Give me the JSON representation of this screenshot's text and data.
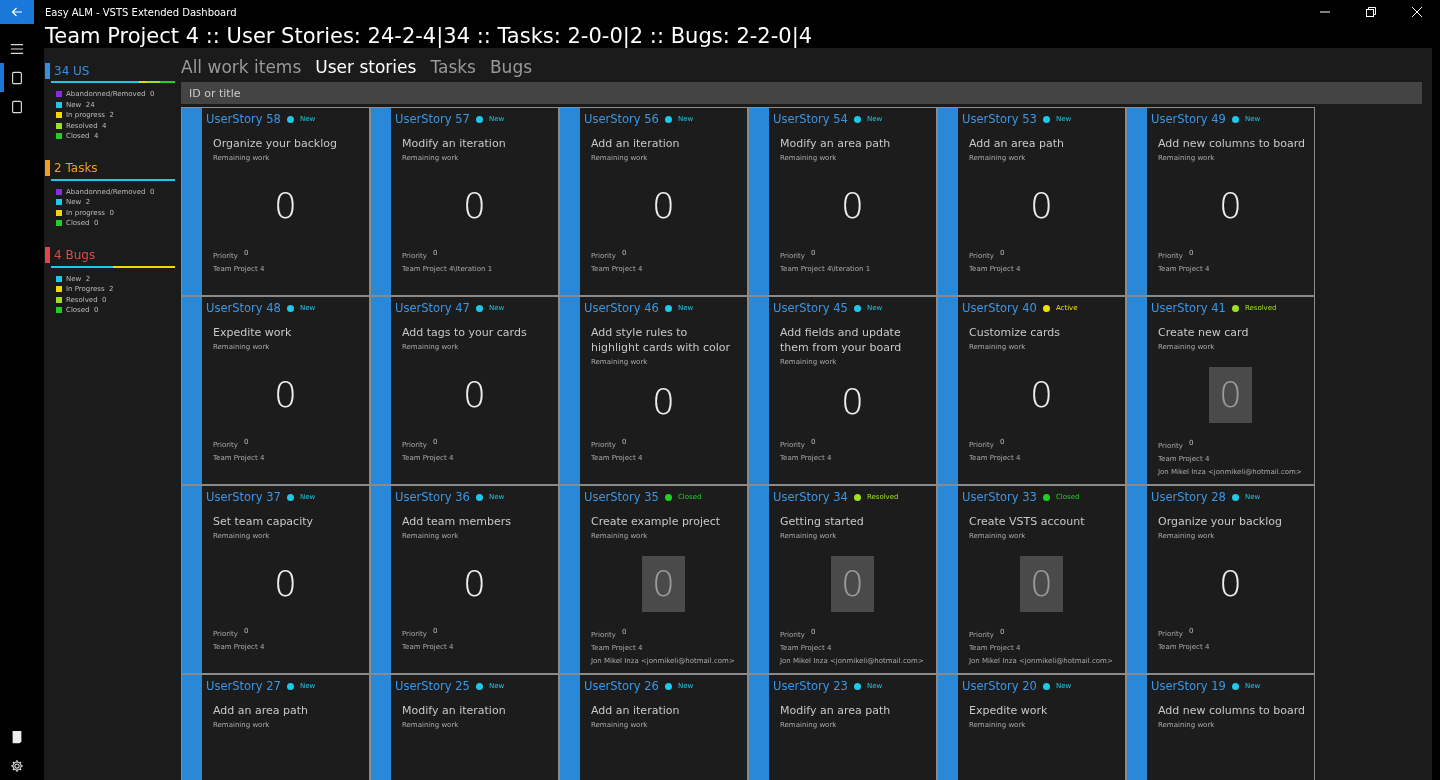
{
  "window": {
    "title": "Easy ALM - VSTS Extended Dashboard"
  },
  "nav": {
    "items": [
      {
        "kind": "menu",
        "selected": false
      },
      {
        "kind": "document",
        "selected": true
      },
      {
        "kind": "document",
        "selected": false
      }
    ],
    "bottom": [
      {
        "kind": "note"
      },
      {
        "kind": "settings"
      }
    ]
  },
  "header": {
    "title": "Team Project 4 :: User Stories: 24-2-4|34 :: Tasks: 2-0-0|2 :: Bugs: 2-2-0|4"
  },
  "summary": [
    {
      "title": "34 US",
      "color": "#3a8ee0",
      "items": [
        {
          "label": "Abandonned/Removed",
          "count": "0",
          "color": "#8a2be2"
        },
        {
          "label": "New",
          "count": "24",
          "color": "#1ec8e8"
        },
        {
          "label": "In progress",
          "count": "2",
          "color": "#f0d800"
        },
        {
          "label": "Resolved",
          "count": "4",
          "color": "#a0e020"
        },
        {
          "label": "Closed",
          "count": "4",
          "color": "#20d020"
        }
      ]
    },
    {
      "title": "2 Tasks",
      "color": "#f0a020",
      "items": [
        {
          "label": "Abandonned/Removed",
          "count": "0",
          "color": "#8a2be2"
        },
        {
          "label": "New",
          "count": "2",
          "color": "#1ec8e8"
        },
        {
          "label": "In progress",
          "count": "0",
          "color": "#f0d800"
        },
        {
          "label": "Closed",
          "count": "0",
          "color": "#20d020"
        }
      ]
    },
    {
      "title": "4 Bugs",
      "color": "#e04848",
      "items": [
        {
          "label": "New",
          "count": "2",
          "color": "#1ec8e8"
        },
        {
          "label": "In Progress",
          "count": "2",
          "color": "#f0d800"
        },
        {
          "label": "Resolved",
          "count": "0",
          "color": "#a0e020"
        },
        {
          "label": "Closed",
          "count": "0",
          "color": "#20d020"
        }
      ]
    }
  ],
  "tabs": [
    {
      "label": "All work items",
      "selected": false
    },
    {
      "label": "User stories",
      "selected": true
    },
    {
      "label": "Tasks",
      "selected": false
    },
    {
      "label": "Bugs",
      "selected": false
    }
  ],
  "search": {
    "placeholder": "ID or title"
  },
  "cards": [
    {
      "id": "UserStory 58",
      "status": "New",
      "color": "#1ec8e8",
      "title": "Organize your backlog",
      "remaining_label": "Remaining work",
      "remaining": "0",
      "highlighted": false,
      "priority_label": "Priority",
      "priority": "0",
      "path": "Team Project 4"
    },
    {
      "id": "UserStory 57",
      "status": "New",
      "color": "#1ec8e8",
      "title": "Modify an iteration",
      "remaining_label": "Remaining work",
      "remaining": "0",
      "highlighted": false,
      "priority_label": "Priority",
      "priority": "0",
      "path": "Team Project 4\\Iteration 1"
    },
    {
      "id": "UserStory 56",
      "status": "New",
      "color": "#1ec8e8",
      "title": "Add an iteration",
      "remaining_label": "Remaining work",
      "remaining": "0",
      "highlighted": false,
      "priority_label": "Priority",
      "priority": "0",
      "path": "Team Project 4"
    },
    {
      "id": "UserStory 54",
      "status": "New",
      "color": "#1ec8e8",
      "title": "Modify an area path",
      "remaining_label": "Remaining work",
      "remaining": "0",
      "highlighted": false,
      "priority_label": "Priority",
      "priority": "0",
      "path": "Team Project 4\\Iteration 1"
    },
    {
      "id": "UserStory 53",
      "status": "New",
      "color": "#1ec8e8",
      "title": "Add an area path",
      "remaining_label": "Remaining work",
      "remaining": "0",
      "highlighted": false,
      "priority_label": "Priority",
      "priority": "0",
      "path": "Team Project 4"
    },
    {
      "id": "UserStory 49",
      "status": "New",
      "color": "#1ec8e8",
      "title": "Add new columns to board",
      "remaining_label": "Remaining work",
      "remaining": "0",
      "highlighted": false,
      "priority_label": "Priority",
      "priority": "0",
      "path": "Team Project 4"
    },
    {
      "id": "UserStory 48",
      "status": "New",
      "color": "#1ec8e8",
      "title": "Expedite work",
      "remaining_label": "Remaining work",
      "remaining": "0",
      "highlighted": false,
      "priority_label": "Priority",
      "priority": "0",
      "path": "Team Project 4"
    },
    {
      "id": "UserStory 47",
      "status": "New",
      "color": "#1ec8e8",
      "title": "Add tags to your cards",
      "remaining_label": "Remaining work",
      "remaining": "0",
      "highlighted": false,
      "priority_label": "Priority",
      "priority": "0",
      "path": "Team Project 4"
    },
    {
      "id": "UserStory 46",
      "status": "New",
      "color": "#1ec8e8",
      "title": "Add style rules to highlight cards with color",
      "remaining_label": "Remaining work",
      "remaining": "0",
      "highlighted": false,
      "priority_label": "Priority",
      "priority": "0",
      "path": "Team Project 4"
    },
    {
      "id": "UserStory 45",
      "status": "New",
      "color": "#1ec8e8",
      "title": "Add fields and update them from your board",
      "remaining_label": "Remaining work",
      "remaining": "0",
      "highlighted": false,
      "priority_label": "Priority",
      "priority": "0",
      "path": "Team Project 4"
    },
    {
      "id": "UserStory 40",
      "status": "Active",
      "color": "#f0e000",
      "title": "Customize cards",
      "remaining_label": "Remaining work",
      "remaining": "0",
      "highlighted": false,
      "priority_label": "Priority",
      "priority": "0",
      "path": "Team Project 4"
    },
    {
      "id": "UserStory 41",
      "status": "Resolved",
      "color": "#a0e020",
      "title": "Create new card",
      "remaining_label": "Remaining work",
      "remaining": "0",
      "highlighted": true,
      "priority_label": "Priority",
      "priority": "0",
      "path": "Team Project 4",
      "assignee": "Jon Mikel Inza <jonmikeli@hotmail.com>"
    },
    {
      "id": "UserStory 37",
      "status": "New",
      "color": "#1ec8e8",
      "title": "Set team capacity",
      "remaining_label": "Remaining work",
      "remaining": "0",
      "highlighted": false,
      "priority_label": "Priority",
      "priority": "0",
      "path": "Team Project 4"
    },
    {
      "id": "UserStory 36",
      "status": "New",
      "color": "#1ec8e8",
      "title": "Add team members",
      "remaining_label": "Remaining work",
      "remaining": "0",
      "highlighted": false,
      "priority_label": "Priority",
      "priority": "0",
      "path": "Team Project 4"
    },
    {
      "id": "UserStory 35",
      "status": "Closed",
      "color": "#20d020",
      "title": "Create example project",
      "remaining_label": "Remaining work",
      "remaining": "0",
      "highlighted": true,
      "priority_label": "Priority",
      "priority": "0",
      "path": "Team Project 4",
      "assignee": "Jon Mikel Inza <jonmikeli@hotmail.com>"
    },
    {
      "id": "UserStory 34",
      "status": "Resolved",
      "color": "#a0e020",
      "title": "Getting started",
      "remaining_label": "Remaining work",
      "remaining": "0",
      "highlighted": true,
      "priority_label": "Priority",
      "priority": "0",
      "path": "Team Project 4",
      "assignee": "Jon Mikel Inza <jonmikeli@hotmail.com>"
    },
    {
      "id": "UserStory 33",
      "status": "Closed",
      "color": "#20d020",
      "title": "Create VSTS account",
      "remaining_label": "Remaining work",
      "remaining": "0",
      "highlighted": true,
      "priority_label": "Priority",
      "priority": "0",
      "path": "Team Project 4",
      "assignee": "Jon Mikel Inza <jonmikeli@hotmail.com>"
    },
    {
      "id": "UserStory 28",
      "status": "New",
      "color": "#1ec8e8",
      "title": "Organize your backlog",
      "remaining_label": "Remaining work",
      "remaining": "0",
      "highlighted": false,
      "priority_label": "Priority",
      "priority": "0",
      "path": "Team Project 4"
    },
    {
      "id": "UserStory 27",
      "status": "New",
      "color": "#1ec8e8",
      "title": "Add an area path",
      "remaining_label": "Remaining work"
    },
    {
      "id": "UserStory 25",
      "status": "New",
      "color": "#1ec8e8",
      "title": "Modify an iteration",
      "remaining_label": "Remaining work"
    },
    {
      "id": "UserStory 26",
      "status": "New",
      "color": "#1ec8e8",
      "title": "Add an iteration",
      "remaining_label": "Remaining work"
    },
    {
      "id": "UserStory 23",
      "status": "New",
      "color": "#1ec8e8",
      "title": "Modify an area path",
      "remaining_label": "Remaining work"
    },
    {
      "id": "UserStory 20",
      "status": "New",
      "color": "#1ec8e8",
      "title": "Expedite work",
      "remaining_label": "Remaining work"
    },
    {
      "id": "UserStory 19",
      "status": "New",
      "color": "#1ec8e8",
      "title": "Add new columns to board",
      "remaining_label": "Remaining work"
    }
  ]
}
